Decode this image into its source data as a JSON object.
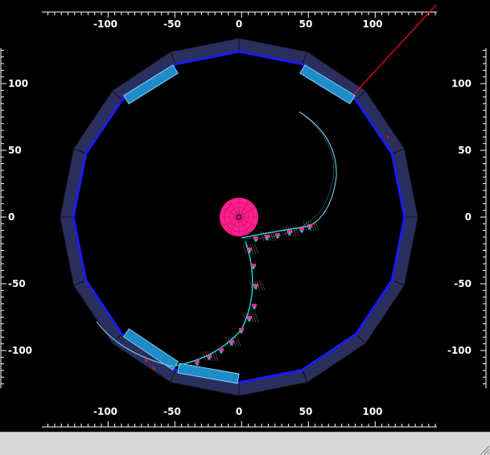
{
  "axes": {
    "top_ticks": [
      "-100",
      "-50",
      "0",
      "50",
      "100"
    ],
    "bottom_ticks": [
      "-100",
      "-50",
      "0",
      "50",
      "100"
    ],
    "left_ticks": [
      "100",
      "50",
      "0",
      "-50",
      "-100"
    ],
    "right_ticks": [
      "100",
      "50",
      "0",
      "-50",
      "-100"
    ]
  },
  "colors": {
    "background": "#000000",
    "ruler": "#ffffff",
    "detector_ring": "#2a2f5e",
    "detector_edge": "#1a1aff",
    "active_module": "#1e8cc8",
    "vertex": "#ff1e8c",
    "track": "#7fdcff",
    "hit": "#ff2d9a",
    "segment": "#1ecbd0",
    "laser": "#ff1010",
    "status_bar": "#d8d8d8"
  },
  "icons": {
    "grip": "resize-grip-icon"
  }
}
